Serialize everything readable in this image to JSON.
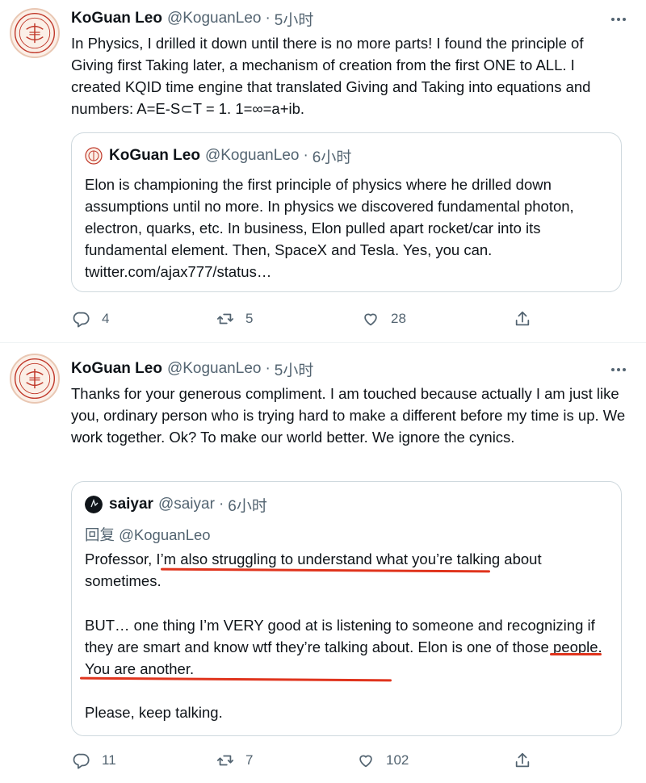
{
  "tweets": [
    {
      "author": {
        "name": "KoGuan Leo",
        "handle": "@KoguanLeo"
      },
      "dot": "·",
      "time": "5小时",
      "text": "In Physics, I drilled it down until there is no more parts! I found the principle of Giving first Taking later, a mechanism of creation from the first ONE to ALL. I created KQID time engine that translated Giving and Taking into equations and numbers: A=E-S⊂T = 1. 1=∞=a+ib.",
      "quote": {
        "author": {
          "name": "KoGuan Leo",
          "handle": "@KoguanLeo"
        },
        "dot": "·",
        "time": "6小时",
        "text": "Elon is championing the first principle of physics where he drilled down assumptions until no more. In physics we discovered fundamental photon, electron, quarks, etc. In business, Elon pulled apart rocket/car into its fundamental element. Then, SpaceX and Tesla. Yes, you can. twitter.com/ajax777/status…"
      },
      "actions": {
        "replies": "4",
        "retweets": "5",
        "likes": "28"
      }
    },
    {
      "author": {
        "name": "KoGuan Leo",
        "handle": "@KoguanLeo"
      },
      "dot": "·",
      "time": "5小时",
      "text": "Thanks for your generous compliment. I am touched because actually I am just like you, ordinary person who is trying hard to make a different before my time is up. We work together. Ok? To make our world better. We ignore the cynics.",
      "quote": {
        "author": {
          "name": "saiyar",
          "handle": "@saiyar"
        },
        "dot": "·",
        "time": "6小时",
        "reply_to": "回复 @KoguanLeo",
        "paragraphs": [
          "Professor, I’m also struggling to understand what you’re talking about sometimes.",
          "BUT… one thing I’m VERY good at is listening to someone and recognizing if they are smart and know wtf they’re talking about.  Elon is one of those people.  You are another.",
          "Please, keep talking."
        ]
      },
      "actions": {
        "replies": "11",
        "retweets": "7",
        "likes": "102"
      }
    }
  ],
  "icons": {
    "reply": "reply-icon",
    "retweet": "retweet-icon",
    "like": "heart-icon",
    "share": "share-icon",
    "more": "more-icon"
  },
  "colors": {
    "annotation_underline": "#e0341d",
    "secondary_text": "#536471",
    "border": "#cfd9de"
  }
}
